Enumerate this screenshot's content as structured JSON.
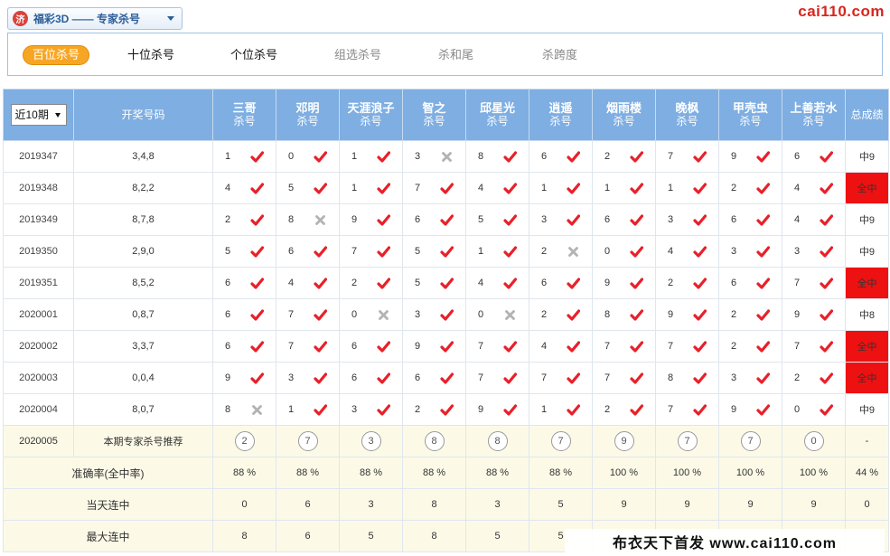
{
  "header": {
    "lottery_select": "福彩3D —— 专家杀号",
    "logo_text": "济",
    "brand": "cai110.com"
  },
  "tabs": [
    {
      "label": "百位杀号",
      "state": "active"
    },
    {
      "label": "十位杀号",
      "state": "bold"
    },
    {
      "label": "个位杀号",
      "state": "bold"
    },
    {
      "label": "组选杀号",
      "state": "dim"
    },
    {
      "label": "杀和尾",
      "state": "dim"
    },
    {
      "label": "杀跨度",
      "state": "dim"
    }
  ],
  "table": {
    "period_select": "近10期",
    "draw_header": "开奖号码",
    "total_header": "总成绩",
    "expert_sub": "杀号",
    "experts": [
      "三哥",
      "邓明",
      "天涯浪子",
      "智之",
      "邱星光",
      "逍遥",
      "烟雨楼",
      "晚枫",
      "甲壳虫",
      "上善若水"
    ],
    "rows": [
      {
        "issue": "2019347",
        "draw": "3,4,8",
        "picks": [
          [
            "1",
            "ok"
          ],
          [
            "0",
            "ok"
          ],
          [
            "1",
            "ok"
          ],
          [
            "3",
            "x"
          ],
          [
            "8",
            "ok"
          ],
          [
            "6",
            "ok"
          ],
          [
            "2",
            "ok"
          ],
          [
            "7",
            "ok"
          ],
          [
            "9",
            "ok"
          ],
          [
            "6",
            "ok"
          ]
        ],
        "result": "中9",
        "full": false
      },
      {
        "issue": "2019348",
        "draw": "8,2,2",
        "picks": [
          [
            "4",
            "ok"
          ],
          [
            "5",
            "ok"
          ],
          [
            "1",
            "ok"
          ],
          [
            "7",
            "ok"
          ],
          [
            "4",
            "ok"
          ],
          [
            "1",
            "ok"
          ],
          [
            "1",
            "ok"
          ],
          [
            "1",
            "ok"
          ],
          [
            "2",
            "ok"
          ],
          [
            "4",
            "ok"
          ]
        ],
        "result": "全中",
        "full": true
      },
      {
        "issue": "2019349",
        "draw": "8,7,8",
        "picks": [
          [
            "2",
            "ok"
          ],
          [
            "8",
            "x"
          ],
          [
            "9",
            "ok"
          ],
          [
            "6",
            "ok"
          ],
          [
            "5",
            "ok"
          ],
          [
            "3",
            "ok"
          ],
          [
            "6",
            "ok"
          ],
          [
            "3",
            "ok"
          ],
          [
            "6",
            "ok"
          ],
          [
            "4",
            "ok"
          ]
        ],
        "result": "中9",
        "full": false
      },
      {
        "issue": "2019350",
        "draw": "2,9,0",
        "picks": [
          [
            "5",
            "ok"
          ],
          [
            "6",
            "ok"
          ],
          [
            "7",
            "ok"
          ],
          [
            "5",
            "ok"
          ],
          [
            "1",
            "ok"
          ],
          [
            "2",
            "x"
          ],
          [
            "0",
            "ok"
          ],
          [
            "4",
            "ok"
          ],
          [
            "3",
            "ok"
          ],
          [
            "3",
            "ok"
          ]
        ],
        "result": "中9",
        "full": false
      },
      {
        "issue": "2019351",
        "draw": "8,5,2",
        "picks": [
          [
            "6",
            "ok"
          ],
          [
            "4",
            "ok"
          ],
          [
            "2",
            "ok"
          ],
          [
            "5",
            "ok"
          ],
          [
            "4",
            "ok"
          ],
          [
            "6",
            "ok"
          ],
          [
            "9",
            "ok"
          ],
          [
            "2",
            "ok"
          ],
          [
            "6",
            "ok"
          ],
          [
            "7",
            "ok"
          ]
        ],
        "result": "全中",
        "full": true
      },
      {
        "issue": "2020001",
        "draw": "0,8,7",
        "picks": [
          [
            "6",
            "ok"
          ],
          [
            "7",
            "ok"
          ],
          [
            "0",
            "x"
          ],
          [
            "3",
            "ok"
          ],
          [
            "0",
            "x"
          ],
          [
            "2",
            "ok"
          ],
          [
            "8",
            "ok"
          ],
          [
            "9",
            "ok"
          ],
          [
            "2",
            "ok"
          ],
          [
            "9",
            "ok"
          ]
        ],
        "result": "中8",
        "full": false
      },
      {
        "issue": "2020002",
        "draw": "3,3,7",
        "picks": [
          [
            "6",
            "ok"
          ],
          [
            "7",
            "ok"
          ],
          [
            "6",
            "ok"
          ],
          [
            "9",
            "ok"
          ],
          [
            "7",
            "ok"
          ],
          [
            "4",
            "ok"
          ],
          [
            "7",
            "ok"
          ],
          [
            "7",
            "ok"
          ],
          [
            "2",
            "ok"
          ],
          [
            "7",
            "ok"
          ]
        ],
        "result": "全中",
        "full": true
      },
      {
        "issue": "2020003",
        "draw": "0,0,4",
        "picks": [
          [
            "9",
            "ok"
          ],
          [
            "3",
            "ok"
          ],
          [
            "6",
            "ok"
          ],
          [
            "6",
            "ok"
          ],
          [
            "7",
            "ok"
          ],
          [
            "7",
            "ok"
          ],
          [
            "7",
            "ok"
          ],
          [
            "8",
            "ok"
          ],
          [
            "3",
            "ok"
          ],
          [
            "2",
            "ok"
          ]
        ],
        "result": "全中",
        "full": true
      },
      {
        "issue": "2020004",
        "draw": "8,0,7",
        "picks": [
          [
            "8",
            "x"
          ],
          [
            "1",
            "ok"
          ],
          [
            "3",
            "ok"
          ],
          [
            "2",
            "ok"
          ],
          [
            "9",
            "ok"
          ],
          [
            "1",
            "ok"
          ],
          [
            "2",
            "ok"
          ],
          [
            "7",
            "ok"
          ],
          [
            "9",
            "ok"
          ],
          [
            "0",
            "ok"
          ]
        ],
        "result": "中9",
        "full": false
      }
    ],
    "recommend": {
      "issue": "2020005",
      "label": "本期专家杀号推荐",
      "numbers": [
        "2",
        "7",
        "3",
        "8",
        "8",
        "7",
        "9",
        "7",
        "7",
        "0"
      ],
      "result": "-"
    },
    "accuracy": {
      "label": "准确率(全中率)",
      "values": [
        "88 %",
        "88 %",
        "88 %",
        "88 %",
        "88 %",
        "88 %",
        "100 %",
        "100 %",
        "100 %",
        "100 %"
      ],
      "total": "44 %"
    },
    "streak_today": {
      "label": "当天连中",
      "values": [
        "0",
        "6",
        "3",
        "8",
        "3",
        "5",
        "9",
        "9",
        "9",
        "9"
      ],
      "total": "0"
    },
    "streak_max": {
      "label": "最大连中",
      "values": [
        "8",
        "6",
        "5",
        "8",
        "5",
        "5",
        "",
        "",
        "",
        ""
      ],
      "total": ""
    }
  },
  "watermark": "布衣天下首发 www.cai110.com",
  "colors": {
    "header_blue": "#7eaee2",
    "check_red": "#e8202a",
    "cross_gray": "#b3b3b3",
    "full_hit_red": "#ee1111",
    "tab_active": "#f7a623"
  }
}
